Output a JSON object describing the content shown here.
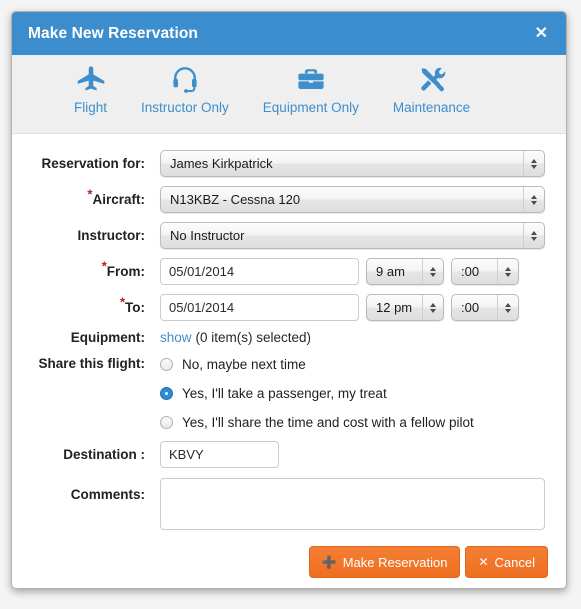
{
  "modal": {
    "title": "Make New Reservation",
    "close_icon": "close-icon",
    "header_color": "#3c8dcd"
  },
  "tabs": [
    {
      "label": "Flight",
      "icon": "airplane-icon"
    },
    {
      "label": "Instructor Only",
      "icon": "headset-icon"
    },
    {
      "label": "Equipment Only",
      "icon": "briefcase-icon"
    },
    {
      "label": "Maintenance",
      "icon": "tools-icon"
    }
  ],
  "form": {
    "reservation_for": {
      "label": "Reservation for:",
      "value": "James Kirkpatrick"
    },
    "aircraft": {
      "label": "Aircraft:",
      "required_marker": "*",
      "value": "N13KBZ - Cessna 120"
    },
    "instructor": {
      "label": "Instructor:",
      "value": "No Instructor"
    },
    "from": {
      "label": "From:",
      "required_marker": "*",
      "date": "05/01/2014",
      "date_placeholder": "mm/dd/yyyy",
      "hour": "9 am",
      "minute": ":00"
    },
    "to": {
      "label": "To:",
      "required_marker": "*",
      "date": "05/01/2014",
      "date_placeholder": "mm/dd/yyyy",
      "hour": "12 pm",
      "minute": ":00"
    },
    "equipment": {
      "label": "Equipment:",
      "link": "show",
      "status": "(0 item(s) selected)"
    },
    "share": {
      "label": "Share this flight:",
      "options": [
        {
          "text": "No, maybe next time",
          "selected": false
        },
        {
          "text": "Yes, I'll take a passenger, my treat",
          "selected": true
        },
        {
          "text": "Yes, I'll share the time and cost with a fellow pilot",
          "selected": false
        }
      ]
    },
    "destination": {
      "label": "Destination :",
      "value": "KBVY",
      "placeholder": ""
    },
    "comments": {
      "label": "Comments:",
      "value": "",
      "placeholder": ""
    }
  },
  "footer": {
    "submit_label": "Make Reservation",
    "submit_icon": "plus-circle-icon",
    "cancel_label": "Cancel",
    "cancel_icon": "x-icon",
    "button_color": "#ee6f22"
  }
}
